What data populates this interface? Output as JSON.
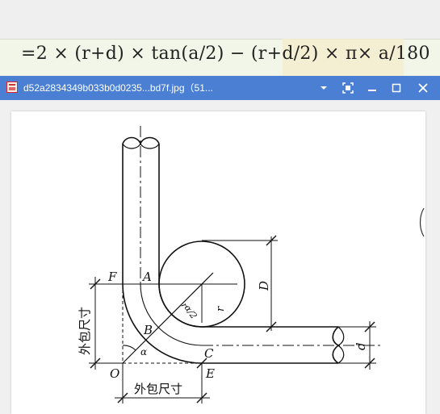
{
  "formula": {
    "text": "=2 × (r+d) × tan(a/2) − (r+d/2) × π× a/180"
  },
  "window": {
    "title": "d52a2834349b033b0d0235...bd7f.jpg（51...",
    "buttons": [
      "dropdown",
      "fit-screen",
      "minimize",
      "maximize",
      "close"
    ]
  },
  "drawing": {
    "labels": {
      "F": "F",
      "A": "A",
      "B": "B",
      "C": "C",
      "E": "E",
      "O": "O",
      "D": "D",
      "r": "r",
      "d": "d",
      "alpha": "α",
      "r_leader": "r",
      "alpha_half": "α/2"
    },
    "dim_left": "外包尺寸",
    "dim_bottom": "外包尺寸"
  },
  "colors": {
    "titlebar": "#4a7fd3",
    "formula_bg": "#f2f6e8",
    "line": "#111111"
  }
}
